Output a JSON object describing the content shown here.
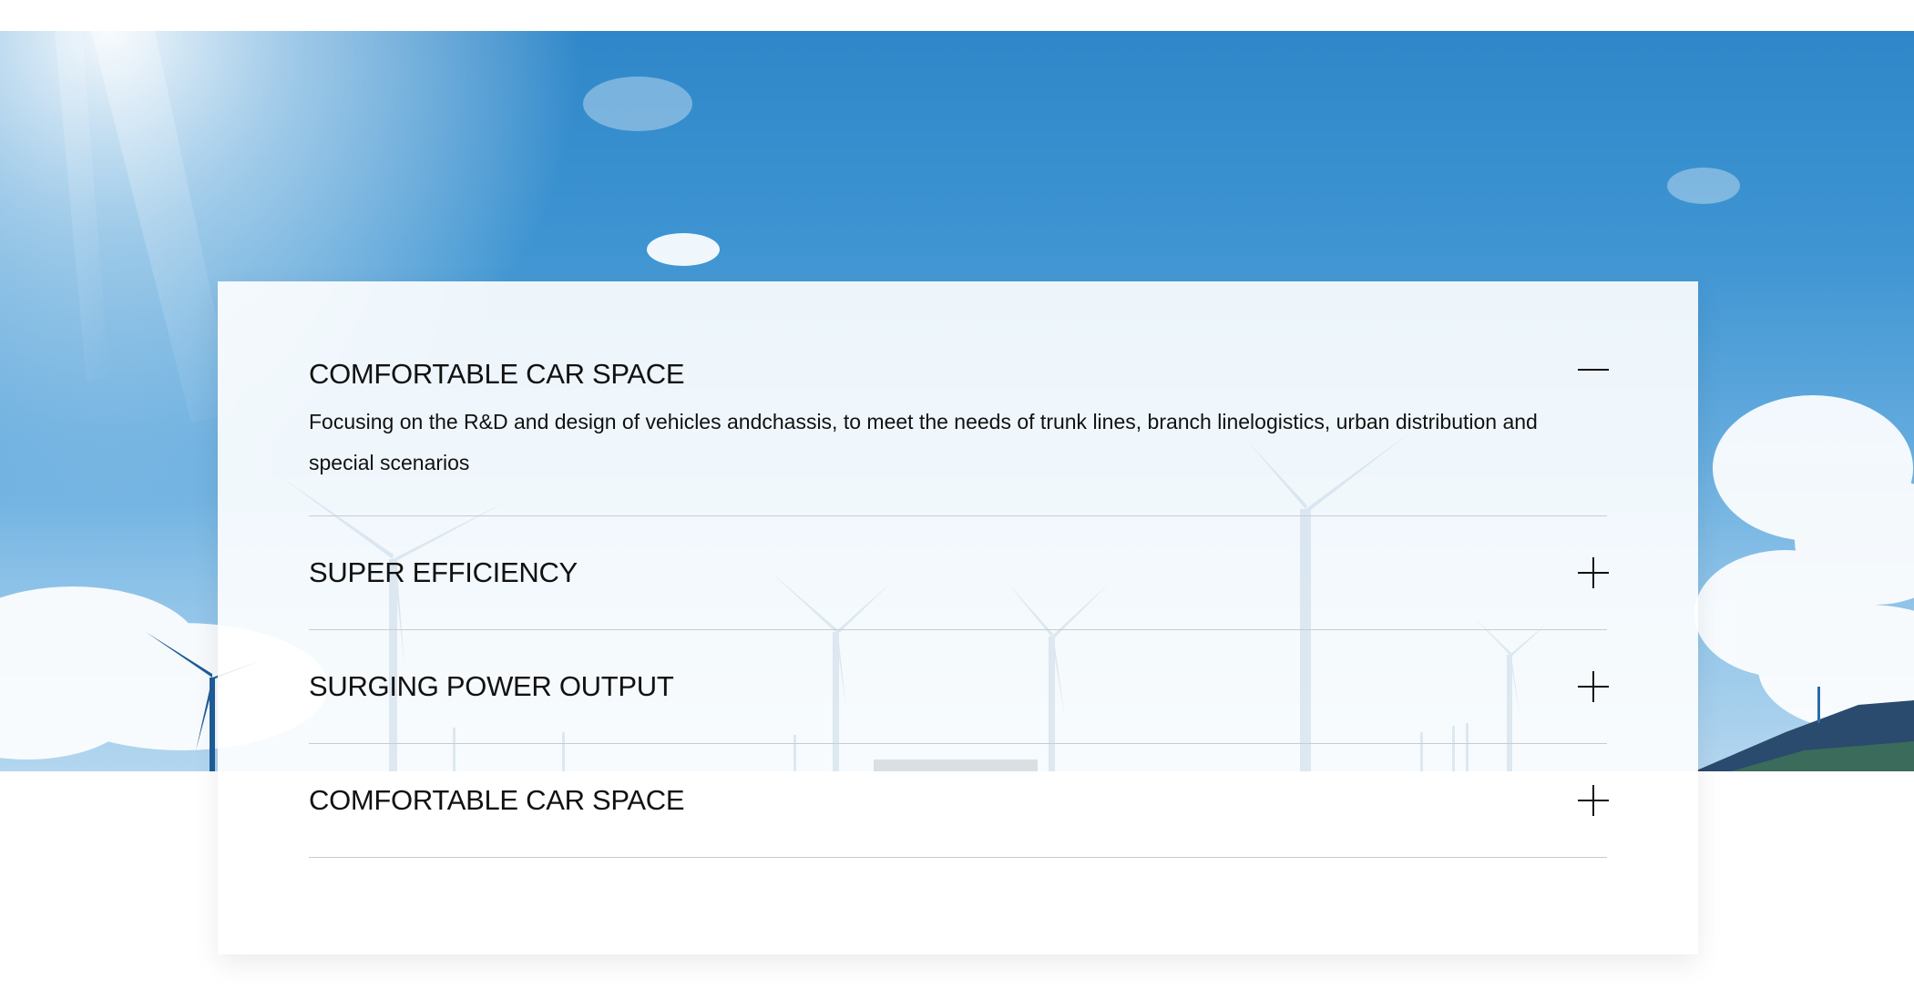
{
  "accordion": {
    "items": [
      {
        "title": "COMFORTABLE CAR SPACE",
        "expanded": true,
        "toggle_icon": "minus-icon",
        "body": "Focusing on the R&D and design of vehicles andchassis, to meet the needs of trunk lines, branch linelogistics, urban distribution and special scenarios"
      },
      {
        "title": "SUPER EFFICIENCY",
        "expanded": false,
        "toggle_icon": "plus-icon"
      },
      {
        "title": "SURGING POWER OUTPUT",
        "expanded": false,
        "toggle_icon": "plus-icon"
      },
      {
        "title": "COMFORTABLE CAR SPACE",
        "expanded": false,
        "toggle_icon": "plus-icon"
      }
    ]
  },
  "colors": {
    "sky": "#2f87c9",
    "panel": "#ffffff",
    "text": "#111111",
    "divider": "#c8ccd0"
  },
  "hero": {
    "image": "wind-turbines-sky-background"
  }
}
